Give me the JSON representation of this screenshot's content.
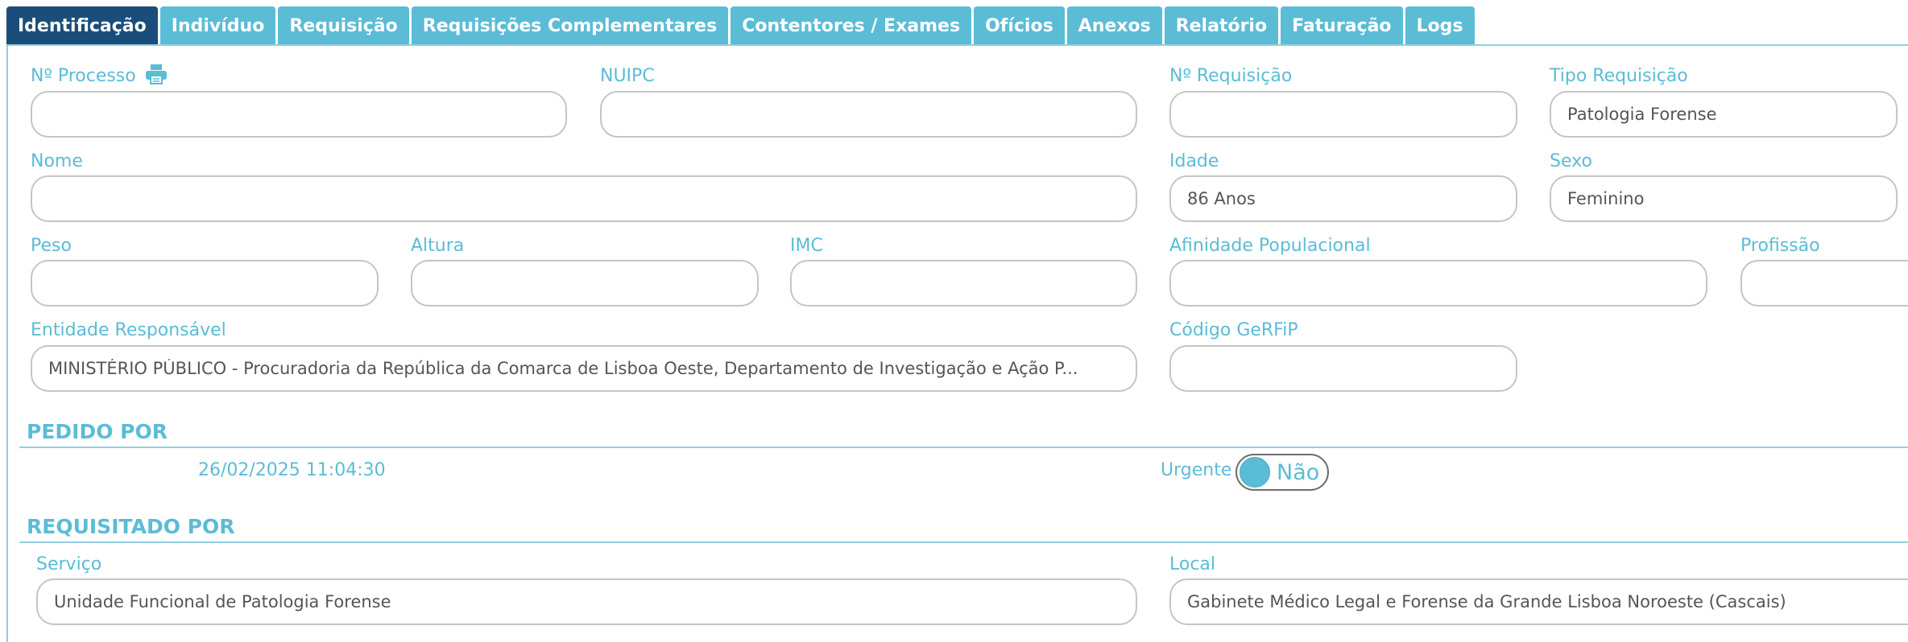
{
  "tabs": [
    {
      "label": "Identificação",
      "active": true
    },
    {
      "label": "Indivíduo"
    },
    {
      "label": "Requisição"
    },
    {
      "label": "Requisições Complementares"
    },
    {
      "label": "Contentores / Exames"
    },
    {
      "label": "Ofícios"
    },
    {
      "label": "Anexos"
    },
    {
      "label": "Relatório"
    },
    {
      "label": "Faturação"
    },
    {
      "label": "Logs"
    }
  ],
  "fields": {
    "processo": {
      "label": "Nº Processo",
      "value": "",
      "icon": "printer-icon"
    },
    "nuipc": {
      "label": "NUIPC",
      "value": ""
    },
    "requisicao": {
      "label": "Nº Requisição",
      "value": ""
    },
    "tipo_requisicao": {
      "label": "Tipo Requisição",
      "value": "Patologia Forense"
    },
    "nome": {
      "label": "Nome",
      "value": ""
    },
    "idade": {
      "label": "Idade",
      "value": "86 Anos"
    },
    "sexo": {
      "label": "Sexo",
      "value": "Feminino"
    },
    "peso": {
      "label": "Peso",
      "value": ""
    },
    "altura": {
      "label": "Altura",
      "value": ""
    },
    "imc": {
      "label": "IMC",
      "value": ""
    },
    "afinidade": {
      "label": "Afinidade Populacional",
      "value": ""
    },
    "profissao": {
      "label": "Profissão",
      "value": ""
    },
    "entidade": {
      "label": "Entidade Responsável",
      "value": "MINISTÉRIO PÚBLICO - Procuradoria da República da Comarca de Lisboa Oeste, Departamento de Investigação e Ação P..."
    },
    "gerfip": {
      "label": "Código GeRFiP",
      "value": ""
    }
  },
  "pedido_por": {
    "title": "PEDIDO POR",
    "datetime": "26/02/2025 11:04:30",
    "urgente_label": "Urgente",
    "urgente_value": "Não"
  },
  "requisitado_por": {
    "title": "REQUISITADO POR",
    "servico_label": "Serviço",
    "servico_value": "Unidade Funcional de Patologia Forense",
    "local_label": "Local",
    "local_value": "Gabinete Médico Legal e Forense da Grande Lisboa Noroeste (Cascais)"
  },
  "colors": {
    "accent": "#5bbcd6",
    "active_tab": "#1a4e7a",
    "border": "#c5c5c5"
  }
}
